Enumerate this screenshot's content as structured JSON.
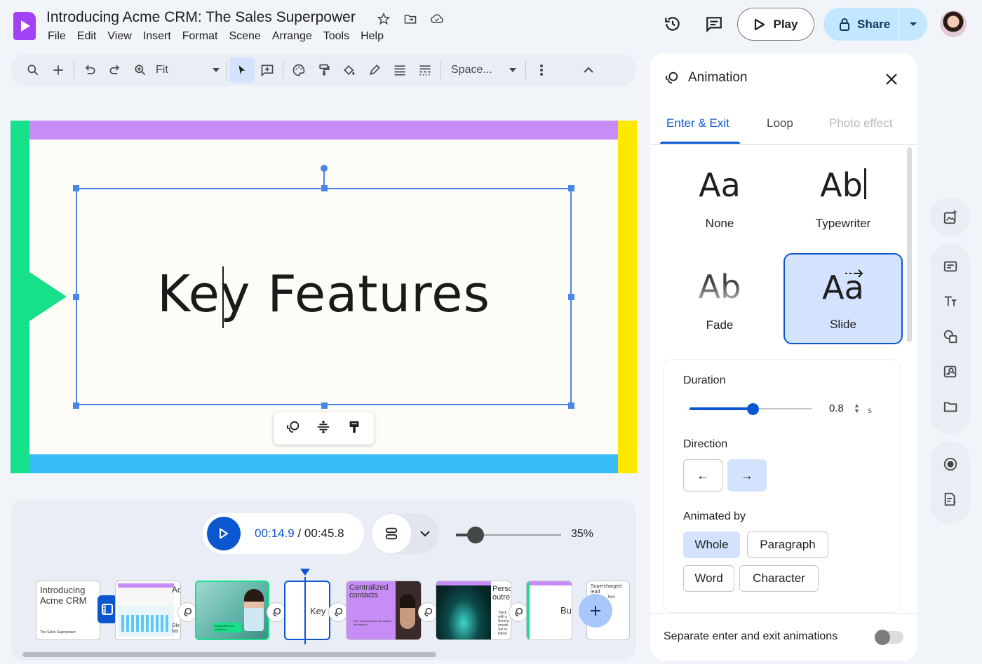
{
  "app": {
    "title": "Introducing Acme CRM: The Sales Superpower",
    "menu": [
      "File",
      "Edit",
      "View",
      "Insert",
      "Format",
      "Scene",
      "Arrange",
      "Tools",
      "Help"
    ],
    "play_label": "Play",
    "share_label": "Share"
  },
  "toolbar": {
    "zoom_label": "Fit",
    "font_label": "Space..."
  },
  "slide": {
    "title": "Key Features",
    "colors": {
      "top": "#c78cf6",
      "left": "#16e08a",
      "right": "#fde800",
      "bottom": "#38bdf8"
    }
  },
  "timeline": {
    "current_time": "00:14.9",
    "total_time": "/ 00:45.8",
    "zoom": "35%",
    "zoom_fraction": 0.17,
    "thumbnails": [
      {
        "text": "Introducing Acme CRM",
        "small": "The Sales Superpower"
      },
      {
        "text": "Ac",
        "small": "Olo fas"
      },
      {
        "text": "",
        "small": "Sales efficiency redefined"
      },
      {
        "text": "Key",
        "small": ""
      },
      {
        "text": "Centralized contacts",
        "small": "One click access to all contact information"
      },
      {
        "text": "",
        "small": ""
      },
      {
        "text": "Persc outre",
        "small": "Track with a Send p emails Set re follow"
      },
      {
        "text": "Bu",
        "small": ""
      },
      {
        "text": "Supercharged lead",
        "small": "tion"
      }
    ]
  },
  "panel": {
    "title": "Animation",
    "tabs": [
      "Enter & Exit",
      "Loop",
      "Photo effect"
    ],
    "animations": [
      {
        "glyph": "Aa",
        "label": "None"
      },
      {
        "glyph": "Ab",
        "label": "Typewriter"
      },
      {
        "glyph": "Ab",
        "label": "Fade"
      },
      {
        "glyph": "Aa",
        "label": "Slide",
        "selected": true
      }
    ],
    "duration_label": "Duration",
    "duration_value": "0.8",
    "duration_fraction": 0.52,
    "duration_unit": "s",
    "direction_label": "Direction",
    "direction_left": "←",
    "direction_right": "→",
    "animated_by_label": "Animated by",
    "animated_by": [
      "Whole",
      "Paragraph",
      "Word",
      "Character"
    ],
    "animated_by_selected": "Whole",
    "separate_label": "Separate enter and exit animations"
  }
}
